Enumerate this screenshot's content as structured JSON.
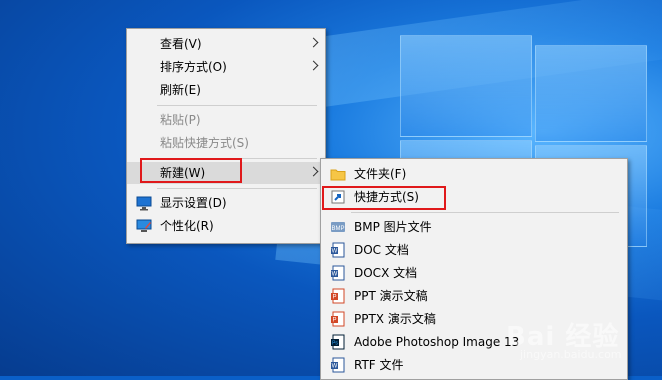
{
  "context_menu": {
    "items": [
      {
        "label": "查看(V)"
      },
      {
        "label": "排序方式(O)"
      },
      {
        "label": "刷新(E)"
      },
      {
        "label": "粘贴(P)"
      },
      {
        "label": "粘贴快捷方式(S)"
      },
      {
        "label": "新建(W)"
      },
      {
        "label": "显示设置(D)"
      },
      {
        "label": "个性化(R)"
      }
    ]
  },
  "new_submenu": {
    "items": [
      {
        "label": "文件夹(F)"
      },
      {
        "label": "快捷方式(S)"
      },
      {
        "label": "BMP 图片文件"
      },
      {
        "label": "DOC 文档"
      },
      {
        "label": "DOCX 文档"
      },
      {
        "label": "PPT 演示文稿"
      },
      {
        "label": "PPTX 演示文稿"
      },
      {
        "label": "Adobe Photoshop Image 13"
      },
      {
        "label": "RTF 文件"
      }
    ]
  },
  "watermark": {
    "text": "Bai 经验",
    "sub": "jingyan.baidu.com"
  },
  "colors": {
    "highlight_box": "#e0191b",
    "menu_bg": "#f2f2f2"
  }
}
